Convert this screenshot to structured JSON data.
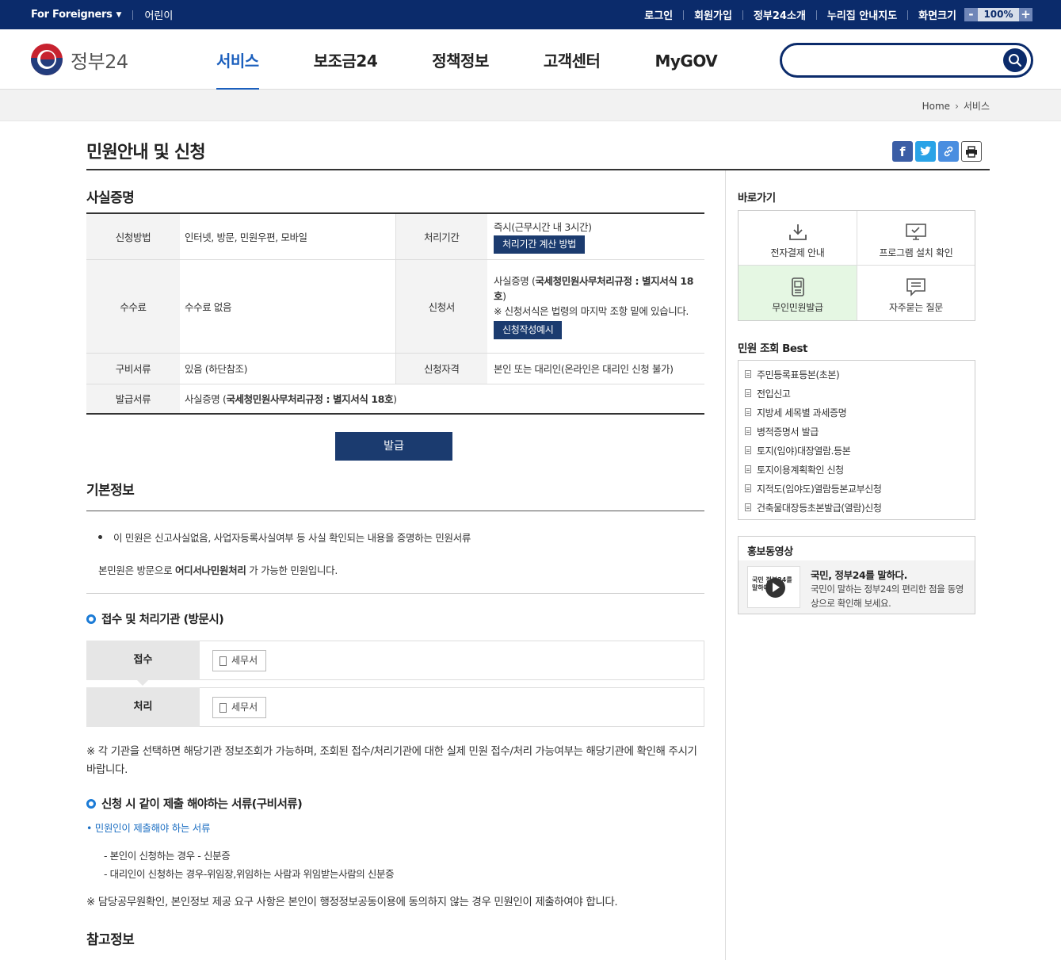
{
  "topbar": {
    "foreigners": "For Foreigners",
    "kids": "어린이",
    "links": [
      "로그인",
      "회원가입",
      "정부24소개",
      "누리집 안내지도",
      "화면크기"
    ],
    "zoom_minus": "-",
    "zoom_value": "100%",
    "zoom_plus": "+"
  },
  "header": {
    "logo_text": "정부24",
    "nav": [
      "서비스",
      "보조금24",
      "정책정보",
      "고객센터",
      "MyGOV"
    ],
    "active_nav": "서비스",
    "search_placeholder": ""
  },
  "breadcrumb": {
    "home": "Home",
    "current": "서비스"
  },
  "page": {
    "title": "민원안내 및 신청"
  },
  "summary": {
    "heading": "사실증명",
    "method_label": "신청방법",
    "method_value": "인터넷, 방문, 민원우편, 모바일",
    "period_label": "처리기간",
    "period_value": "즉시(근무시간 내 3시간)",
    "period_button": "처리기간 계산 방법",
    "fee_label": "수수료",
    "fee_value": "수수료 없음",
    "form_label": "신청서",
    "form_value_prefix": "사실증명 (",
    "form_value_bold": "국세청민원사무처리규정 : 별지서식 18호",
    "form_value_suffix": ")",
    "form_note": "※ 신청서식은 법령의 마지막 조항 밑에 있습니다.",
    "form_button": "신청작성예시",
    "docs_label": "구비서류",
    "docs_value": "있음 (하단참조)",
    "qual_label": "신청자격",
    "qual_value": "본인 또는 대리인(온라인은 대리인 신청 불가)",
    "issue_label": "발급서류",
    "issue_value_prefix": "사실증명 (",
    "issue_value_bold": "국세청민원사무처리규정 : 별지서식 18호",
    "issue_value_suffix": ")"
  },
  "issue_button": "발급",
  "basic": {
    "heading": "기본정보",
    "bullet": "이 민원은 신고사실없음, 사업자등록사실여부 등 사실 확인되는 내용을 증명하는 민원서류",
    "note_prefix": "본민원은 방문으로 ",
    "note_bold": "어디서나민원처리",
    "note_suffix": " 가 가능한 민원입니다."
  },
  "agency": {
    "heading": "접수 및 처리기관 (방문시)",
    "rows": [
      {
        "label": "접수",
        "office": "세무서"
      },
      {
        "label": "처리",
        "office": "세무서"
      }
    ],
    "note": "※ 각 기관을 선택하면 해당기관 정보조회가 가능하며, 조회된 접수/처리기관에 대한 실제 민원 접수/처리 가능여부는 해당기관에 확인해 주시기 바랍니다."
  },
  "required_docs": {
    "heading": "신청 시 같이 제출 해야하는 서류(구비서류)",
    "link": "• 민원인이 제출해야 하는 서류",
    "items": [
      "- 본인이 신청하는 경우 - 신분증",
      "- 대리인이 신청하는 경우-위임장,위임하는 사람과 위임받는사람의 신분증"
    ],
    "note": "※ 담당공무원확인, 본인정보 제공 요구 사항은 본인이 행정정보공동이용에 동의하지 않는 경우 민원인이 제출하여야 합니다."
  },
  "reference": {
    "heading": "참고정보"
  },
  "sidebar": {
    "quick_heading": "바로가기",
    "quick": [
      "전자결제 안내",
      "프로그램 설치 확인",
      "무인민원발급",
      "자주묻는 질문"
    ],
    "best_heading": "민원 조회 Best",
    "best": [
      "주민등록표등본(초본)",
      "전입신고",
      "지방세 세목별 과세증명",
      "병적증명서 발급",
      "토지(임야)대장열람.등본",
      "토지이용계획확인 신청",
      "지적도(임야도)열람등본교부신청",
      "건축물대장등초본발급(열람)신청"
    ],
    "promo_heading": "홍보동영상",
    "promo_thumb": "국민 정부24를 말하다",
    "promo_title": "국민, 정부24를 말하다.",
    "promo_desc": "국민이 말하는 정부24의 편리한 점을 동영상으로 확인해 보세요."
  },
  "colors": {
    "navy": "#0b2b6b",
    "accent": "#1b5fbd",
    "button": "#1b3b6f",
    "highlight": "#e5f7e3"
  }
}
